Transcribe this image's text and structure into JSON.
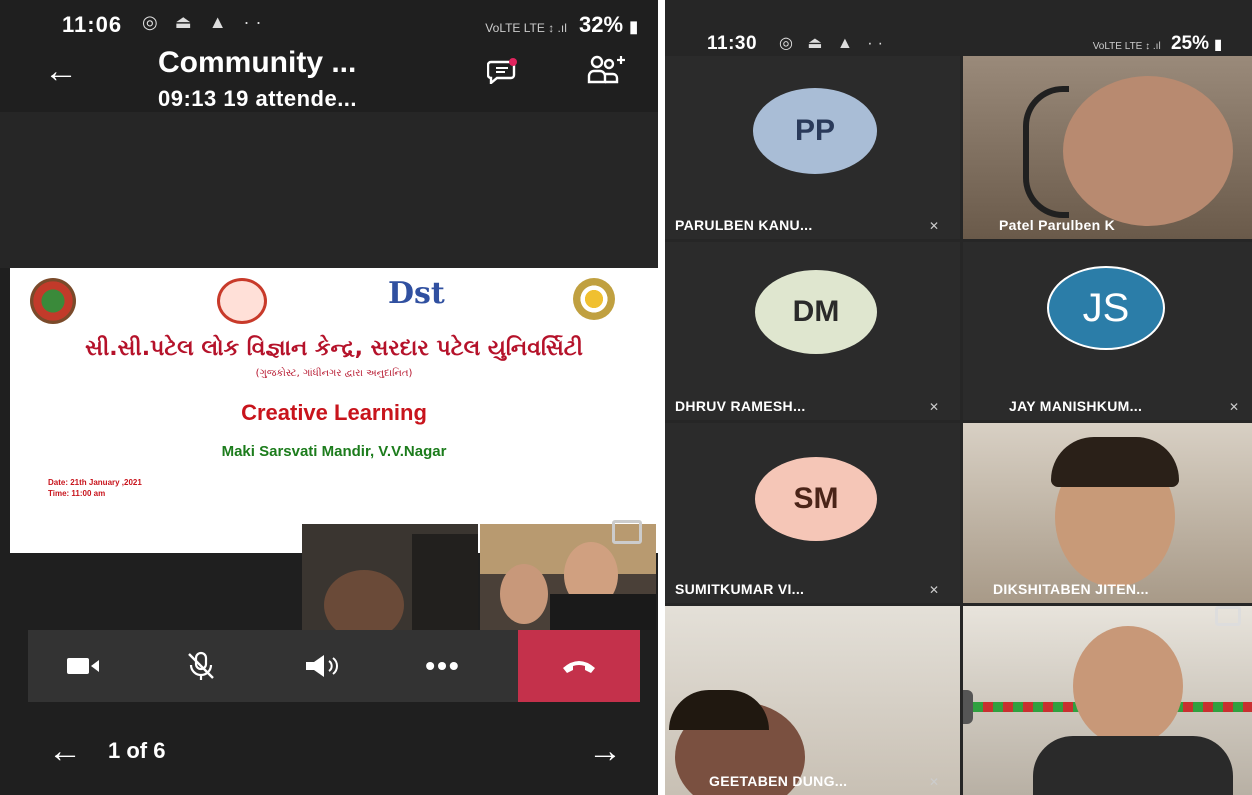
{
  "left_phone": {
    "status": {
      "time": "11:06",
      "icons": "◎ ⏏ ▲ ··",
      "signal": "VoLTE LTE ↕ .ıl",
      "battery": "32%"
    },
    "header": {
      "title": "Community ...",
      "subtitle": "09:13   19 attende..."
    },
    "slide": {
      "title_gujarati": "સી.સી.પટેલ લોક વિજ્ઞાન કેન્દ્ર, સરદાર પટેલ યુનિવર્સિટી",
      "subtitle_gujarati": "(ગુજકોસ્ટ, ગાંધીનગર દ્વારા અનુદાનિત)",
      "heading": "Creative Learning",
      "school": "Maki  Sarsvati Mandir, V.V.Nagar",
      "date": "Date: 21th  January ,2021",
      "time": "Time: 11:00 am",
      "dst_logo_text": "Dst"
    },
    "pager": {
      "label": "1 of 6"
    },
    "colors": {
      "hangup": "#c4314b",
      "accent_red": "#c8141c",
      "school_green": "#1c7c1c"
    }
  },
  "right_phone": {
    "status": {
      "time": "11:30",
      "icons": "◎ ⏏ ▲ ··",
      "signal": "VoLTE LTE ↕ .ıl",
      "battery": "25%"
    },
    "tiles": [
      {
        "initials": "PP",
        "name": "PARULBEN KANU...",
        "avatar_bg": "#a9bdd6",
        "avatar_fg": "#2a3a5a"
      },
      {
        "name": "Patel Parulben  K"
      },
      {
        "initials": "DM",
        "name": "DHRUV RAMESH...",
        "avatar_bg": "#dfe6cf",
        "avatar_fg": "#2a2a2a"
      },
      {
        "initials": "JS",
        "name": "JAY MANISHKUM...",
        "avatar_bg": "#2b7da8",
        "avatar_fg": "#ffffff"
      },
      {
        "initials": "SM",
        "name": "SUMITKUMAR VI...",
        "avatar_bg": "#f5c6b7",
        "avatar_fg": "#4a2418"
      },
      {
        "name": "DIKSHITABEN JITEN..."
      },
      {
        "name": "GEETABEN DUNG..."
      },
      {
        "name": ""
      }
    ]
  }
}
